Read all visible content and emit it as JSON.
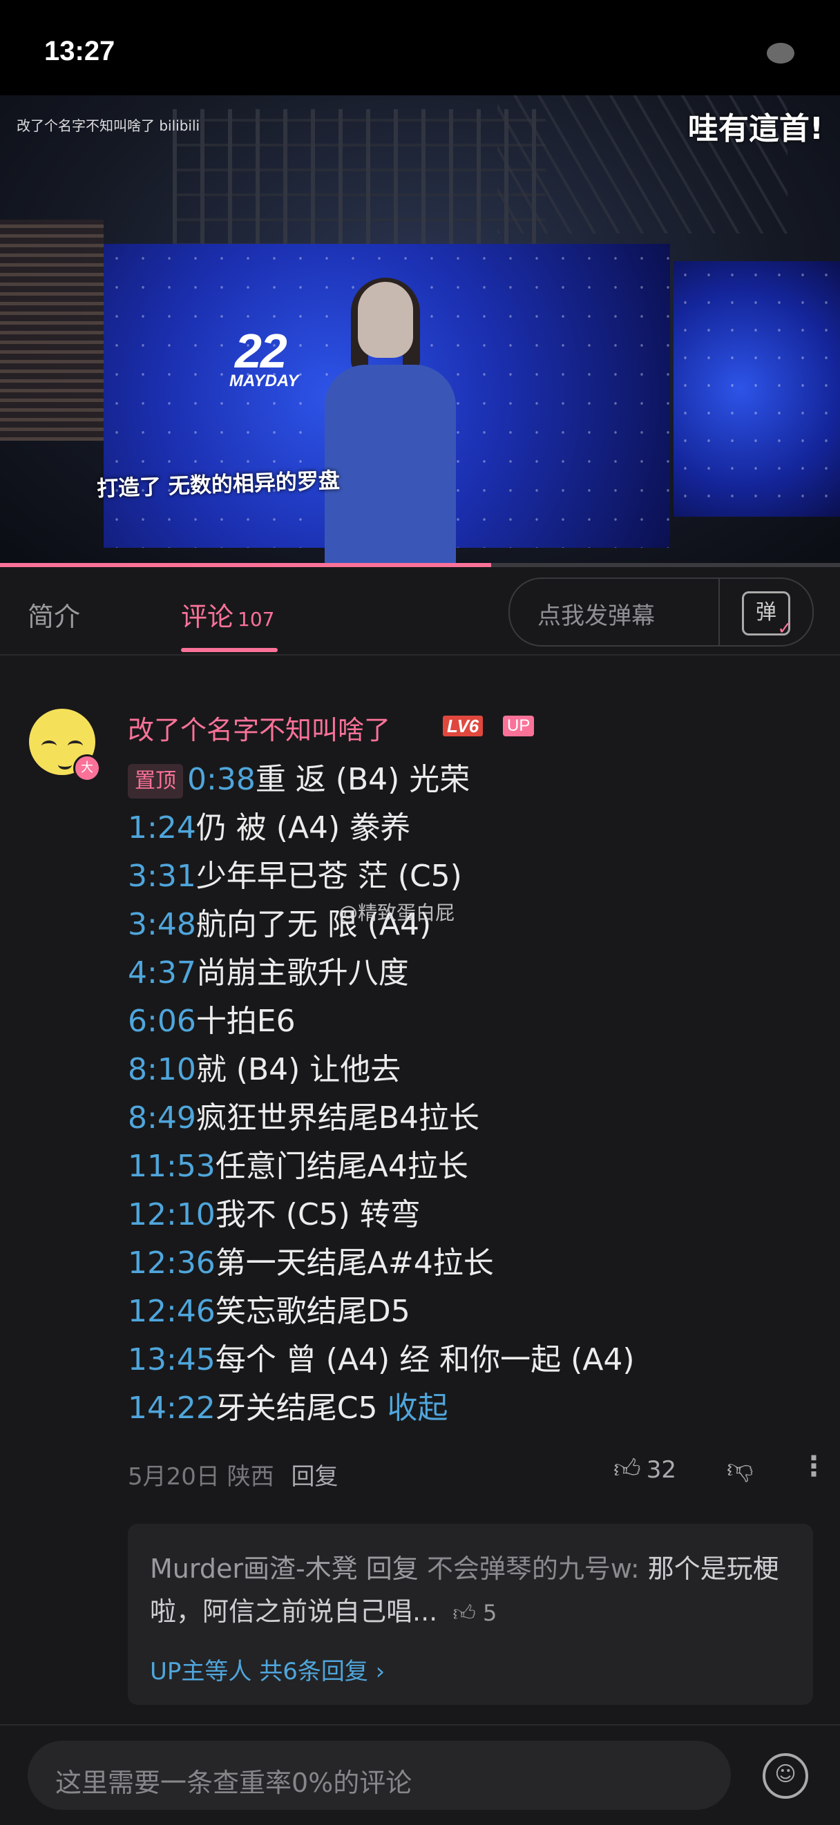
{
  "status_bar": {
    "time": "13:27"
  },
  "video": {
    "uploader_watermark": "改了个名字不知叫啥了 bilibili",
    "overlay_text": "哇有這首!",
    "screen_logo": "22",
    "screen_logo_sub": "MAYDAY",
    "subtitle": "打造了 无数的相异的罗盘",
    "progress": 0.585
  },
  "tabs": {
    "intro_label": "简介",
    "comments_label": "评论",
    "comments_count": "107",
    "danmaku_placeholder": "点我发弹幕",
    "danmaku_button": "弹"
  },
  "comment": {
    "username": "改了个名字不知叫啥了",
    "level_badge": "LV6",
    "up_badge": "UP",
    "avatar_badge": "大",
    "pin_label": "置顶",
    "lines": [
      {
        "time": "0:38",
        "text": "重 返 (B4) 光荣"
      },
      {
        "time": "1:24",
        "text": "仍 被 (A4) 豢养"
      },
      {
        "time": "3:31",
        "text": "少年早已苍 茫 (C5)"
      },
      {
        "time": "3:48",
        "text": "航向了无 限 (A4)"
      },
      {
        "time": "4:37",
        "text": "尚崩主歌升八度"
      },
      {
        "time": "6:06",
        "text": "十拍E6"
      },
      {
        "time": "8:10",
        "text": "就 (B4) 让他去"
      },
      {
        "time": "8:49",
        "text": "疯狂世界结尾B4拉长"
      },
      {
        "time": "11:53",
        "text": "任意门结尾A4拉长"
      },
      {
        "time": "12:10",
        "text": "我不 (C5) 转弯"
      },
      {
        "time": "12:36",
        "text": "第一天结尾A#4拉长"
      },
      {
        "time": "12:46",
        "text": "笑忘歌结尾D5"
      },
      {
        "time": "13:45",
        "text": "每个 曾 (A4) 经 和你一起 (A4)"
      },
      {
        "time": "14:22",
        "text": "牙关结尾C5"
      }
    ],
    "collapse_label": "收起",
    "image_watermark": "@精致蛋白屁",
    "date": "5月20日",
    "location": "陕西",
    "reply_label": "回复",
    "likes": "32",
    "reply_preview": {
      "author": "Murder画渣-木凳",
      "reply_word": "回复",
      "target": "不会弹琴的九号w:",
      "text": "那个是玩梗啦，阿信之前说自己唱...",
      "likes": "5",
      "summary": "UP主等人 共6条回复"
    }
  },
  "bottom": {
    "input_placeholder": "这里需要一条查重率0%的评论"
  }
}
